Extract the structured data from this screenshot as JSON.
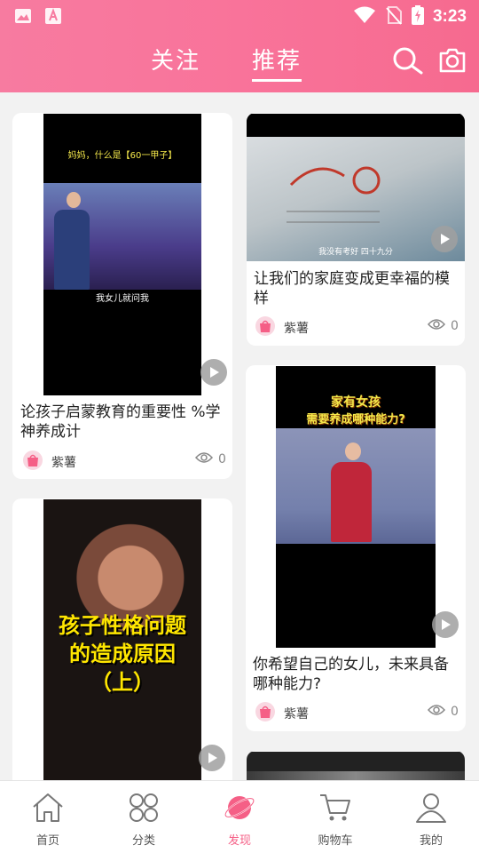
{
  "status_bar": {
    "time": "3:23"
  },
  "header": {
    "tabs": [
      {
        "label": "关注",
        "active": false
      },
      {
        "label": "推荐",
        "active": true
      }
    ]
  },
  "feed": {
    "left": [
      {
        "title": "论孩子启蒙教育的重要性 %学神养成计",
        "author": "紫薯",
        "views": "0",
        "thumb": {
          "caption_top": "妈妈，什么是【60一甲子】",
          "caption_bottom": "我女儿就问我"
        }
      },
      {
        "title": "",
        "thumb": {
          "caption_line1": "孩子性格问题",
          "caption_line2": "的造成原因",
          "caption_line3": "（上）"
        }
      }
    ],
    "right": [
      {
        "title": "让我们的家庭变成更幸福的模样",
        "author": "紫薯",
        "views": "0",
        "thumb": {
          "caption_bottom": "我没有考好 四十九分"
        }
      },
      {
        "title": "你希望自己的女儿，未来具备哪种能力?",
        "author": "紫薯",
        "views": "0",
        "thumb": {
          "caption_line1": "家有女孩",
          "caption_line2": "需要养成哪种能力?"
        }
      }
    ]
  },
  "tabbar": [
    {
      "label": "首页",
      "icon": "home-icon"
    },
    {
      "label": "分类",
      "icon": "category-icon"
    },
    {
      "label": "发现",
      "icon": "planet-icon",
      "active": true
    },
    {
      "label": "购物车",
      "icon": "cart-icon"
    },
    {
      "label": "我的",
      "icon": "user-icon"
    }
  ],
  "colors": {
    "accent": "#f55f86",
    "header_start": "#f77ba0",
    "header_end": "#f66a8f"
  }
}
